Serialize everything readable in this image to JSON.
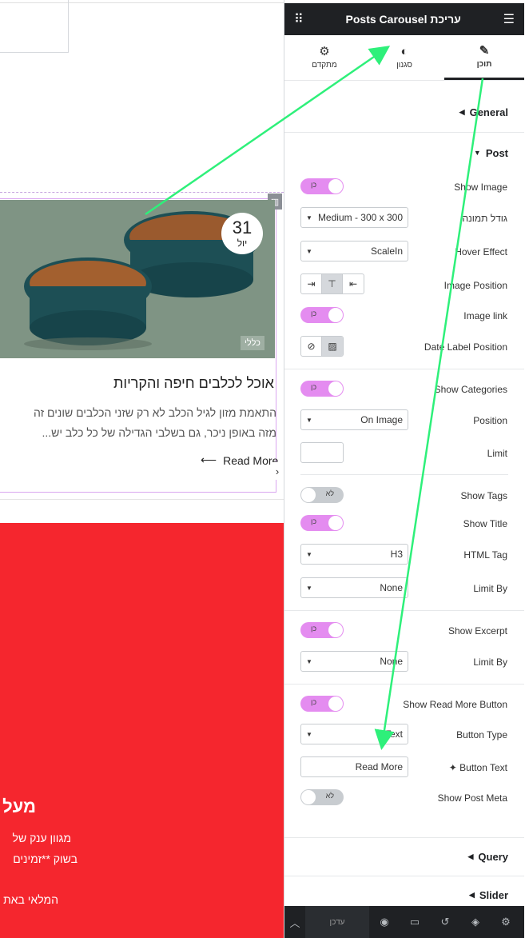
{
  "canvas": {
    "post": {
      "date_day": "31",
      "date_month": "יול",
      "category": "כללי",
      "title": "אוכל לכלבים חיפה והקריות",
      "excerpt_lines": [
        "התאמת מזון לגיל הכלב לא רק שזני הכלבים שונים זה",
        "מזה באופן ניכר, גם בשלבי הגדילה של כל כלב יש..."
      ],
      "read_more": "Read More"
    },
    "red": {
      "title": "מעל",
      "line1": "מגוון ענק של",
      "line2": "בשוק **זמינים",
      "line3": "המלאי באת"
    }
  },
  "panel": {
    "header_title": "Posts Carousel עריכת",
    "tabs": [
      {
        "label": "תוכן",
        "icon": "✎"
      },
      {
        "label": "סגנון",
        "icon": "◐"
      },
      {
        "label": "מתקדם",
        "icon": "⚙"
      }
    ],
    "sections": {
      "general": "General",
      "post": "Post",
      "query": "Query",
      "slider": "Slider"
    },
    "controls": {
      "show_image": {
        "label": "Show Image",
        "value": "כן"
      },
      "image_size": {
        "label": "גודל תמונה",
        "value": "Medium - 300 x 300"
      },
      "hover_effect": {
        "label": "Hover Effect",
        "value": "ScaleIn"
      },
      "image_position": {
        "label": "Image Position"
      },
      "image_link": {
        "label": "Image link",
        "value": "כן"
      },
      "date_label_position": {
        "label": "Date Label Position"
      },
      "show_categories": {
        "label": "Show Categories",
        "value": "כן"
      },
      "position": {
        "label": "Position",
        "value": "On Image"
      },
      "limit": {
        "label": "Limit",
        "value": ""
      },
      "show_tags": {
        "label": "Show Tags",
        "value": "לא"
      },
      "show_title": {
        "label": "Show Title",
        "value": "כן"
      },
      "html_tag": {
        "label": "HTML Tag",
        "value": "H3"
      },
      "limit_by_title": {
        "label": "Limit By",
        "value": "None"
      },
      "show_excerpt": {
        "label": "Show Excerpt",
        "value": "כן"
      },
      "limit_by_excerpt": {
        "label": "Limit By",
        "value": "None"
      },
      "show_read_more": {
        "label": "Show Read More Button",
        "value": "כן"
      },
      "button_type": {
        "label": "Button Type",
        "value": "Text"
      },
      "button_text": {
        "label": "Button Text",
        "value": "Read More"
      },
      "show_post_meta": {
        "label": "Show Post Meta",
        "value": "לא"
      }
    },
    "footer": {
      "update_label": "עדכן"
    }
  },
  "colors": {
    "toggle_on": "#e48cf0",
    "arrow": "#2ef07a",
    "red_section": "#f5262e",
    "header": "#1f2124"
  }
}
